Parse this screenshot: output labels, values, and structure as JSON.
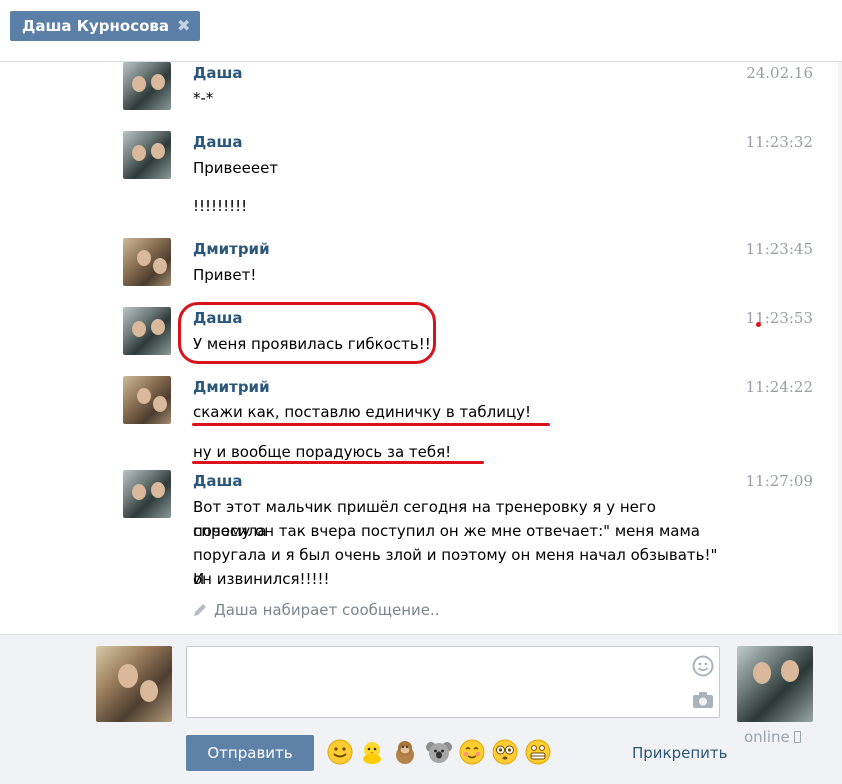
{
  "header": {
    "tab_title": "Даша Курносова",
    "close_glyph": "✖"
  },
  "messages": [
    {
      "author": "Даша",
      "time": "24.02.16",
      "lines": [
        "*-*"
      ]
    },
    {
      "author": "Даша",
      "time": "11:23:32",
      "lines": [
        "Привеееет",
        "!!!!!!!!!"
      ]
    },
    {
      "author": "Дмитрий",
      "time": "11:23:45",
      "lines": [
        "Привет!"
      ]
    },
    {
      "author": "Даша",
      "time": "11:23:53",
      "lines": [
        "У меня проявилась гибкость!!!"
      ]
    },
    {
      "author": "Дмитрий",
      "time": "11:24:22",
      "lines": [
        "скажи как, поставлю единичку в таблицу!",
        "ну и вообще порадуюсь за тебя!"
      ]
    },
    {
      "author": "Даша",
      "time": "11:27:09",
      "lines": [
        "Вот этот мальчик пришёл сегодня на тренеровку я у него спросила",
        "почему он так вчера поступил он же мне отвечает:\" меня мама",
        "поругала и я был очень злой и поэтому он меня начал обзывать!\" И",
        "он извинился!!!!!"
      ]
    }
  ],
  "typing_indicator": "Даша набирает сообщение..",
  "composer": {
    "send_label": "Отправить",
    "attach_label": "Прикрепить",
    "status": "online",
    "emojis": [
      "smile-emoji",
      "chick-emoji",
      "monkey-emoji",
      "koala-emoji",
      "blush-emoji",
      "flushed-emoji",
      "grimace-emoji"
    ]
  },
  "colors": {
    "accent": "#5e81a8",
    "author": "#2b587a",
    "annotation": "#d9131c"
  }
}
